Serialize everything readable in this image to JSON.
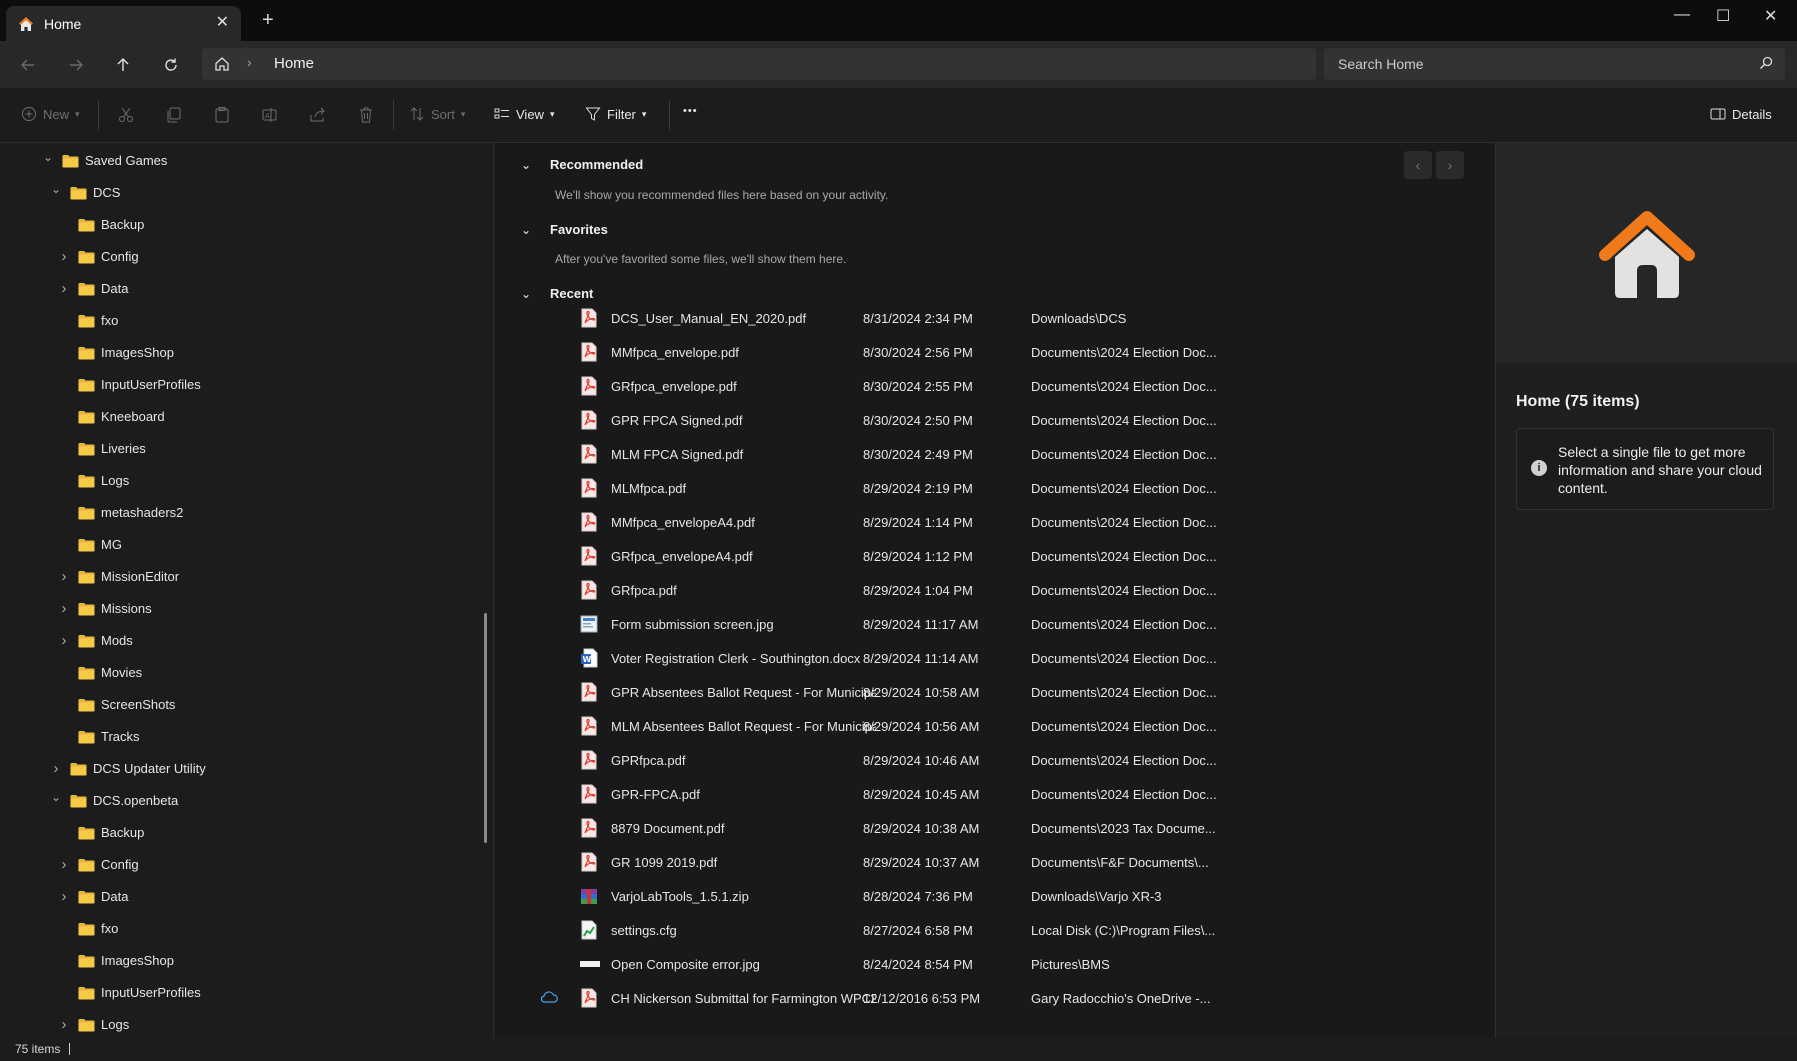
{
  "window": {
    "tab_title": "Home",
    "tab_close": "✕",
    "new_tab": "+",
    "minimize": "—",
    "maximize": "☐",
    "close": "✕"
  },
  "address": {
    "crumb": "Home",
    "search_placeholder": "Search Home"
  },
  "toolbar": {
    "new_label": "New",
    "sort_label": "Sort",
    "view_label": "View",
    "filter_label": "Filter",
    "more_label": "•••",
    "details_label": "Details"
  },
  "sidebar": {
    "items": [
      {
        "label": "Saved Games",
        "arrow": "expanded"
      },
      {
        "label": "DCS",
        "arrow": "expanded"
      },
      {
        "label": "Backup",
        "arrow": "none"
      },
      {
        "label": "Config",
        "arrow": "collapsed"
      },
      {
        "label": "Data",
        "arrow": "collapsed"
      },
      {
        "label": "fxo",
        "arrow": "none"
      },
      {
        "label": "ImagesShop",
        "arrow": "none"
      },
      {
        "label": "InputUserProfiles",
        "arrow": "none"
      },
      {
        "label": "Kneeboard",
        "arrow": "none"
      },
      {
        "label": "Liveries",
        "arrow": "none"
      },
      {
        "label": "Logs",
        "arrow": "none"
      },
      {
        "label": "metashaders2",
        "arrow": "none"
      },
      {
        "label": "MG",
        "arrow": "none"
      },
      {
        "label": "MissionEditor",
        "arrow": "collapsed"
      },
      {
        "label": "Missions",
        "arrow": "collapsed"
      },
      {
        "label": "Mods",
        "arrow": "collapsed"
      },
      {
        "label": "Movies",
        "arrow": "none"
      },
      {
        "label": "ScreenShots",
        "arrow": "none"
      },
      {
        "label": "Tracks",
        "arrow": "none"
      },
      {
        "label": "DCS Updater Utility",
        "arrow": "collapsed"
      },
      {
        "label": "DCS.openbeta",
        "arrow": "expanded"
      },
      {
        "label": "Backup",
        "arrow": "none"
      },
      {
        "label": "Config",
        "arrow": "collapsed"
      },
      {
        "label": "Data",
        "arrow": "collapsed"
      },
      {
        "label": "fxo",
        "arrow": "none"
      },
      {
        "label": "ImagesShop",
        "arrow": "none"
      },
      {
        "label": "InputUserProfiles",
        "arrow": "none"
      },
      {
        "label": "Logs",
        "arrow": "collapsed"
      }
    ]
  },
  "main": {
    "recommended": {
      "title": "Recommended",
      "subtitle": "We'll show you recommended files here based on your activity."
    },
    "favorites": {
      "title": "Favorites",
      "subtitle": "After you've favorited some files, we'll show them here."
    },
    "recent": {
      "title": "Recent",
      "files": [
        {
          "name": "DCS_User_Manual_EN_2020.pdf",
          "date": "8/31/2024 2:34 PM",
          "location": "Downloads\\DCS",
          "icon": "pdf-icon"
        },
        {
          "name": "MMfpca_envelope.pdf",
          "date": "8/30/2024 2:56 PM",
          "location": "Documents\\2024 Election Doc...",
          "icon": "pdf-icon"
        },
        {
          "name": "GRfpca_envelope.pdf",
          "date": "8/30/2024 2:55 PM",
          "location": "Documents\\2024 Election Doc...",
          "icon": "pdf-icon"
        },
        {
          "name": "GPR FPCA Signed.pdf",
          "date": "8/30/2024 2:50 PM",
          "location": "Documents\\2024 Election Doc...",
          "icon": "pdf-icon"
        },
        {
          "name": "MLM FPCA Signed.pdf",
          "date": "8/30/2024 2:49 PM",
          "location": "Documents\\2024 Election Doc...",
          "icon": "pdf-icon"
        },
        {
          "name": "MLMfpca.pdf",
          "date": "8/29/2024 2:19 PM",
          "location": "Documents\\2024 Election Doc...",
          "icon": "pdf-icon"
        },
        {
          "name": "MMfpca_envelopeA4.pdf",
          "date": "8/29/2024 1:14 PM",
          "location": "Documents\\2024 Election Doc...",
          "icon": "pdf-icon"
        },
        {
          "name": "GRfpca_envelopeA4.pdf",
          "date": "8/29/2024 1:12 PM",
          "location": "Documents\\2024 Election Doc...",
          "icon": "pdf-icon"
        },
        {
          "name": "GRfpca.pdf",
          "date": "8/29/2024 1:04 PM",
          "location": "Documents\\2024 Election Doc...",
          "icon": "pdf-icon"
        },
        {
          "name": "Form submission screen.jpg",
          "date": "8/29/2024 11:17 AM",
          "location": "Documents\\2024 Election Doc...",
          "icon": "image-icon"
        },
        {
          "name": "Voter Registration Clerk - Southington.docx",
          "date": "8/29/2024 11:14 AM",
          "location": "Documents\\2024 Election Doc...",
          "icon": "word-icon"
        },
        {
          "name": "GPR Absentees Ballot Request - For Municipal C...",
          "date": "8/29/2024 10:58 AM",
          "location": "Documents\\2024 Election Doc...",
          "icon": "pdf-icon"
        },
        {
          "name": "MLM Absentees Ballot Request - For Municipal...",
          "date": "8/29/2024 10:56 AM",
          "location": "Documents\\2024 Election Doc...",
          "icon": "pdf-icon"
        },
        {
          "name": "GPRfpca.pdf",
          "date": "8/29/2024 10:46 AM",
          "location": "Documents\\2024 Election Doc...",
          "icon": "pdf-icon"
        },
        {
          "name": "GPR-FPCA.pdf",
          "date": "8/29/2024 10:45 AM",
          "location": "Documents\\2024 Election Doc...",
          "icon": "pdf-icon"
        },
        {
          "name": "8879 Document.pdf",
          "date": "8/29/2024 10:38 AM",
          "location": "Documents\\2023 Tax Docume...",
          "icon": "pdf-icon"
        },
        {
          "name": "GR 1099 2019.pdf",
          "date": "8/29/2024 10:37 AM",
          "location": "Documents\\F&F Documents\\...",
          "icon": "pdf-icon"
        },
        {
          "name": "VarjoLabTools_1.5.1.zip",
          "date": "8/28/2024 7:36 PM",
          "location": "Downloads\\Varjo XR-3",
          "icon": "archive-icon"
        },
        {
          "name": "settings.cfg",
          "date": "8/27/2024 6:58 PM",
          "location": "Local Disk (C:)\\Program Files\\...",
          "icon": "config-file-icon"
        },
        {
          "name": "Open Composite error.jpg",
          "date": "8/24/2024 8:54 PM",
          "location": "Pictures\\BMS",
          "icon": "image-white-icon"
        },
        {
          "name": "CH Nickerson Submittal for Farmington WPCF 3...",
          "date": "12/12/2016 6:53 PM",
          "location": "Gary Radocchio's OneDrive -...",
          "icon": "pdf-icon",
          "cloud": true
        }
      ]
    }
  },
  "details": {
    "title": "Home (75 items)",
    "info_text": "Select a single file to get more information and share your cloud content.",
    "info_glyph": "i"
  },
  "status": {
    "item_count": "75 items"
  },
  "colors": {
    "accent_orange": "#f07a1a",
    "folder_yellow": "#f5c242",
    "pdf_red": "#e03a2f",
    "word_blue": "#2b62c8",
    "cloud_blue": "#4aa3f0"
  }
}
